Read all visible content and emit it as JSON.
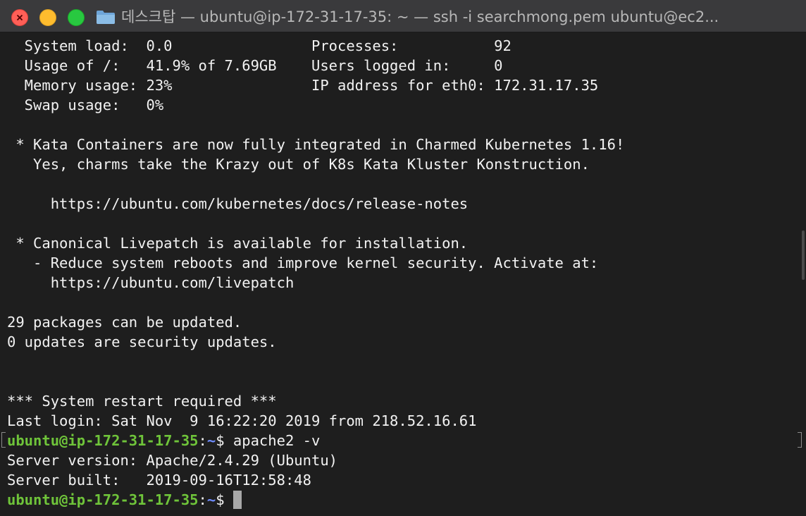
{
  "window": {
    "title": "데스크탑 — ubuntu@ip-172-31-17-35: ~ — ssh -i searchmong.pem ubuntu@ec2...",
    "colors": {
      "background": "#1e1e1e",
      "titlebar": "#3a3a3c",
      "text": "#f2f2f2",
      "prompt_user": "#6fc43a",
      "prompt_path": "#6f8cff",
      "close": "#ff5f57",
      "minimize": "#febc2e",
      "maximize": "#28c840"
    },
    "icons": {
      "close": "close-icon",
      "minimize": "minimize-icon",
      "maximize": "maximize-icon",
      "folder": "folder-icon"
    }
  },
  "terminal": {
    "lines": [
      "  System load:  0.0                Processes:           92",
      "  Usage of /:   41.9% of 7.69GB    Users logged in:     0",
      "  Memory usage: 23%                IP address for eth0: 172.31.17.35",
      "  Swap usage:   0%",
      "",
      " * Kata Containers are now fully integrated in Charmed Kubernetes 1.16!",
      "   Yes, charms take the Krazy out of K8s Kata Kluster Konstruction.",
      "",
      "     https://ubuntu.com/kubernetes/docs/release-notes",
      "",
      " * Canonical Livepatch is available for installation.",
      "   - Reduce system reboots and improve kernel security. Activate at:",
      "     https://ubuntu.com/livepatch",
      "",
      "29 packages can be updated.",
      "0 updates are security updates.",
      "",
      "",
      "*** System restart required ***",
      "Last login: Sat Nov  9 16:22:20 2019 from 218.52.16.61"
    ],
    "prompts": [
      {
        "user_host": "ubuntu@ip-172-31-17-35",
        "separator": ":",
        "path": "~",
        "symbol": "$ ",
        "command": "apache2 -v"
      },
      {
        "user_host": "ubuntu@ip-172-31-17-35",
        "separator": ":",
        "path": "~",
        "symbol": "$ ",
        "command": ""
      }
    ],
    "output": [
      "Server version: Apache/2.4.29 (Ubuntu)",
      "Server built:   2019-09-16T12:58:48"
    ]
  }
}
